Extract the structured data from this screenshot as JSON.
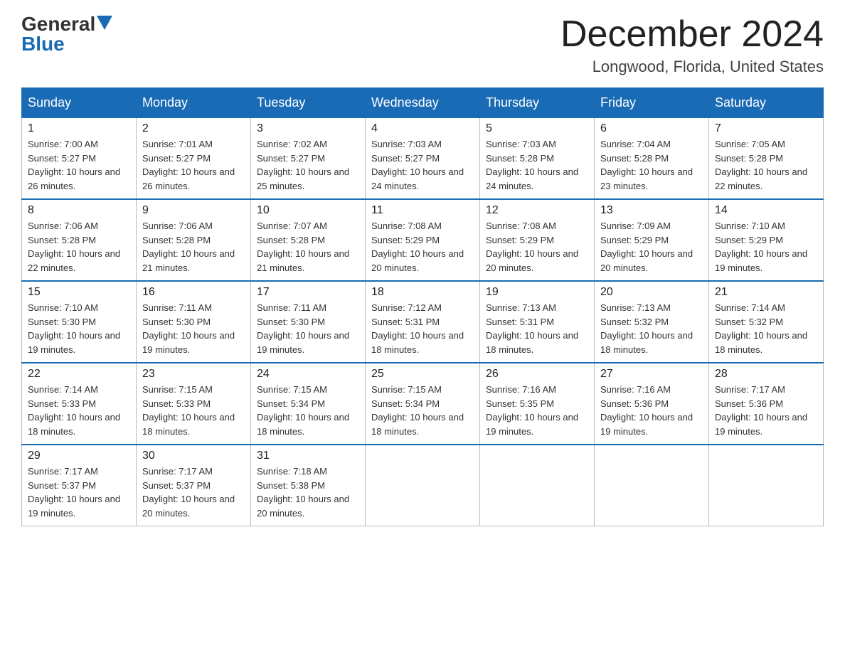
{
  "logo": {
    "general": "General",
    "blue": "Blue"
  },
  "title": "December 2024",
  "location": "Longwood, Florida, United States",
  "days_of_week": [
    "Sunday",
    "Monday",
    "Tuesday",
    "Wednesday",
    "Thursday",
    "Friday",
    "Saturday"
  ],
  "weeks": [
    [
      {
        "day": "1",
        "sunrise": "7:00 AM",
        "sunset": "5:27 PM",
        "daylight": "10 hours and 26 minutes."
      },
      {
        "day": "2",
        "sunrise": "7:01 AM",
        "sunset": "5:27 PM",
        "daylight": "10 hours and 26 minutes."
      },
      {
        "day": "3",
        "sunrise": "7:02 AM",
        "sunset": "5:27 PM",
        "daylight": "10 hours and 25 minutes."
      },
      {
        "day": "4",
        "sunrise": "7:03 AM",
        "sunset": "5:27 PM",
        "daylight": "10 hours and 24 minutes."
      },
      {
        "day": "5",
        "sunrise": "7:03 AM",
        "sunset": "5:28 PM",
        "daylight": "10 hours and 24 minutes."
      },
      {
        "day": "6",
        "sunrise": "7:04 AM",
        "sunset": "5:28 PM",
        "daylight": "10 hours and 23 minutes."
      },
      {
        "day": "7",
        "sunrise": "7:05 AM",
        "sunset": "5:28 PM",
        "daylight": "10 hours and 22 minutes."
      }
    ],
    [
      {
        "day": "8",
        "sunrise": "7:06 AM",
        "sunset": "5:28 PM",
        "daylight": "10 hours and 22 minutes."
      },
      {
        "day": "9",
        "sunrise": "7:06 AM",
        "sunset": "5:28 PM",
        "daylight": "10 hours and 21 minutes."
      },
      {
        "day": "10",
        "sunrise": "7:07 AM",
        "sunset": "5:28 PM",
        "daylight": "10 hours and 21 minutes."
      },
      {
        "day": "11",
        "sunrise": "7:08 AM",
        "sunset": "5:29 PM",
        "daylight": "10 hours and 20 minutes."
      },
      {
        "day": "12",
        "sunrise": "7:08 AM",
        "sunset": "5:29 PM",
        "daylight": "10 hours and 20 minutes."
      },
      {
        "day": "13",
        "sunrise": "7:09 AM",
        "sunset": "5:29 PM",
        "daylight": "10 hours and 20 minutes."
      },
      {
        "day": "14",
        "sunrise": "7:10 AM",
        "sunset": "5:29 PM",
        "daylight": "10 hours and 19 minutes."
      }
    ],
    [
      {
        "day": "15",
        "sunrise": "7:10 AM",
        "sunset": "5:30 PM",
        "daylight": "10 hours and 19 minutes."
      },
      {
        "day": "16",
        "sunrise": "7:11 AM",
        "sunset": "5:30 PM",
        "daylight": "10 hours and 19 minutes."
      },
      {
        "day": "17",
        "sunrise": "7:11 AM",
        "sunset": "5:30 PM",
        "daylight": "10 hours and 19 minutes."
      },
      {
        "day": "18",
        "sunrise": "7:12 AM",
        "sunset": "5:31 PM",
        "daylight": "10 hours and 18 minutes."
      },
      {
        "day": "19",
        "sunrise": "7:13 AM",
        "sunset": "5:31 PM",
        "daylight": "10 hours and 18 minutes."
      },
      {
        "day": "20",
        "sunrise": "7:13 AM",
        "sunset": "5:32 PM",
        "daylight": "10 hours and 18 minutes."
      },
      {
        "day": "21",
        "sunrise": "7:14 AM",
        "sunset": "5:32 PM",
        "daylight": "10 hours and 18 minutes."
      }
    ],
    [
      {
        "day": "22",
        "sunrise": "7:14 AM",
        "sunset": "5:33 PM",
        "daylight": "10 hours and 18 minutes."
      },
      {
        "day": "23",
        "sunrise": "7:15 AM",
        "sunset": "5:33 PM",
        "daylight": "10 hours and 18 minutes."
      },
      {
        "day": "24",
        "sunrise": "7:15 AM",
        "sunset": "5:34 PM",
        "daylight": "10 hours and 18 minutes."
      },
      {
        "day": "25",
        "sunrise": "7:15 AM",
        "sunset": "5:34 PM",
        "daylight": "10 hours and 18 minutes."
      },
      {
        "day": "26",
        "sunrise": "7:16 AM",
        "sunset": "5:35 PM",
        "daylight": "10 hours and 19 minutes."
      },
      {
        "day": "27",
        "sunrise": "7:16 AM",
        "sunset": "5:36 PM",
        "daylight": "10 hours and 19 minutes."
      },
      {
        "day": "28",
        "sunrise": "7:17 AM",
        "sunset": "5:36 PM",
        "daylight": "10 hours and 19 minutes."
      }
    ],
    [
      {
        "day": "29",
        "sunrise": "7:17 AM",
        "sunset": "5:37 PM",
        "daylight": "10 hours and 19 minutes."
      },
      {
        "day": "30",
        "sunrise": "7:17 AM",
        "sunset": "5:37 PM",
        "daylight": "10 hours and 20 minutes."
      },
      {
        "day": "31",
        "sunrise": "7:18 AM",
        "sunset": "5:38 PM",
        "daylight": "10 hours and 20 minutes."
      },
      null,
      null,
      null,
      null
    ]
  ],
  "labels": {
    "sunrise": "Sunrise:",
    "sunset": "Sunset:",
    "daylight": "Daylight:"
  }
}
